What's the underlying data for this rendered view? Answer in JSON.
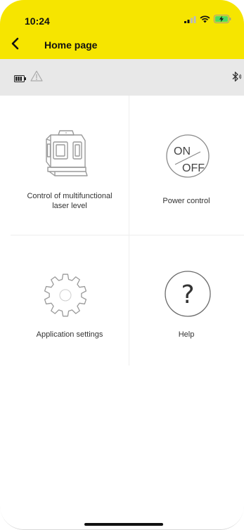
{
  "status_bar": {
    "time": "10:24",
    "signal_icon": "cellular-signal-icon",
    "wifi_icon": "wifi-icon",
    "battery_icon": "charging-battery-icon",
    "battery_color": "#4cd964"
  },
  "nav": {
    "title": "Home page",
    "back_icon": "chevron-left-icon"
  },
  "device_status": {
    "battery_icon": "device-battery-icon",
    "warning_icon": "warning-triangle-icon",
    "bluetooth_icon": "bluetooth-icon"
  },
  "tiles": [
    {
      "label": "Control of multifunctional laser level",
      "icon": "laser-level-icon"
    },
    {
      "label": "Power control",
      "icon": "power-on-off-icon",
      "on_text": "ON",
      "off_text": "OFF"
    },
    {
      "label": "Application settings",
      "icon": "gear-icon"
    },
    {
      "label": "Help",
      "icon": "help-icon",
      "symbol": "?"
    }
  ],
  "colors": {
    "accent": "#f6e500",
    "strip": "#e8e8e8",
    "icon_stroke": "#9a9a9a"
  }
}
